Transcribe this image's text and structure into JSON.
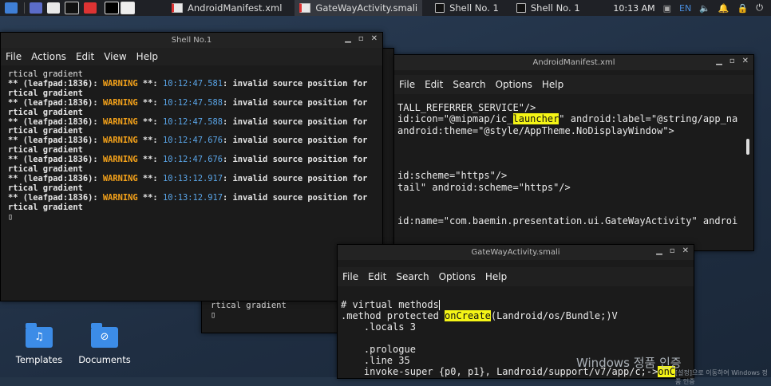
{
  "taskbar": {
    "items": [
      {
        "label": "AndroidManifest.xml",
        "active": false
      },
      {
        "label": "GateWayActivity.smali",
        "active": true
      },
      {
        "label": "Shell No. 1",
        "active": false
      },
      {
        "label": "Shell No. 1",
        "active": false
      }
    ],
    "clock": "10:13 AM",
    "lang": "EN"
  },
  "desktop": {
    "icons": [
      {
        "label": "Templates",
        "icon": "templates-folder-icon"
      },
      {
        "label": "Documents",
        "icon": "documents-folder-icon"
      }
    ]
  },
  "shell_window": {
    "title": "Shell No.1",
    "menu": [
      "File",
      "Actions",
      "Edit",
      "View",
      "Help"
    ],
    "first_line": "rtical gradient",
    "prefix": "** (leafpad:1836): ",
    "warning": "WARNING",
    "stars": " **: ",
    "message": ": invalid source position for ve",
    "cont": "rtical gradient",
    "timestamps": [
      "10:12:47.581",
      "10:12:47.588",
      "10:12:47.588",
      "10:12:47.676",
      "10:12:47.676",
      "10:13:12.917",
      "10:13:12.917"
    ],
    "cursor": "▯"
  },
  "back_shell": {
    "line": "rtical gradient",
    "cursor": "▯"
  },
  "manifest_window": {
    "title": "AndroidManifest.xml",
    "menu": [
      "File",
      "Edit",
      "Search",
      "Options",
      "Help"
    ],
    "lines": [
      {
        "pre": "TALL_REFERRER_SERVICE\"/>",
        "hl": "",
        "post": ""
      },
      {
        "pre": "id:icon=\"@mipmap/ic_",
        "hl": "launcher",
        "post": "\" android:label=\"@string/app_na"
      },
      {
        "pre": "android:theme=\"@style/AppTheme.NoDisplayWindow\">",
        "hl": "",
        "post": ""
      },
      {
        "pre": "",
        "hl": "",
        "post": ""
      },
      {
        "pre": "",
        "hl": "",
        "post": ""
      },
      {
        "pre": "",
        "hl": "",
        "post": ""
      },
      {
        "pre": "id:scheme=\"https\"/>",
        "hl": "",
        "post": ""
      },
      {
        "pre": "tail\" android:scheme=\"https\"/>",
        "hl": "",
        "post": ""
      },
      {
        "pre": "",
        "hl": "",
        "post": ""
      },
      {
        "pre": "",
        "hl": "",
        "post": ""
      },
      {
        "pre": "id:name=\"com.baemin.presentation.ui.GateWayActivity\" androi",
        "hl": "",
        "post": ""
      }
    ]
  },
  "smali_window": {
    "title": "GateWayActivity.smali",
    "menu": [
      "File",
      "Edit",
      "Search",
      "Options",
      "Help"
    ],
    "lines": [
      {
        "pre": "# virtual methods",
        "hl": "",
        "post": "",
        "cursor": true
      },
      {
        "pre": ".method protected ",
        "hl": "onCreate",
        "post": "(Landroid/os/Bundle;)V",
        "cursor": false
      },
      {
        "pre": "    .locals 3",
        "hl": "",
        "post": "",
        "cursor": false
      },
      {
        "pre": "",
        "hl": "",
        "post": "",
        "cursor": false
      },
      {
        "pre": "    .prologue",
        "hl": "",
        "post": "",
        "cursor": false
      },
      {
        "pre": "    .line 35",
        "hl": "",
        "post": "",
        "cursor": false
      },
      {
        "pre": "    invoke-super {p0, p1}, Landroid/support/v7/app/c;->",
        "hl": "onC",
        "post": "",
        "cursor": false
      }
    ]
  },
  "watermark": {
    "main": "Windows 정품 인증",
    "sub": "[설정]으로 이동하여 Windows 정품 인증"
  },
  "colors": {
    "warning": "#f6a31a",
    "timestamp": "#5aa5e8",
    "highlight": "#f5f516",
    "folder": "#3c8ce7"
  }
}
